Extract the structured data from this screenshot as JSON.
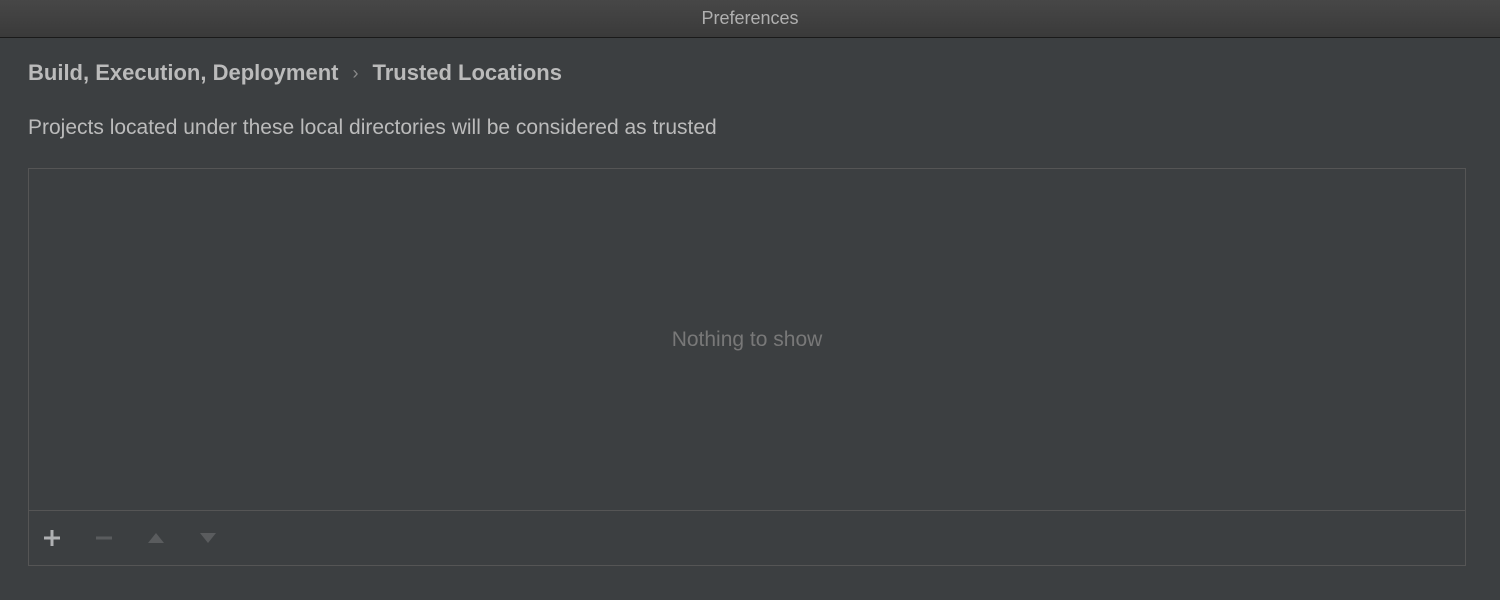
{
  "window": {
    "title": "Preferences"
  },
  "breadcrumb": {
    "parent": "Build, Execution, Deployment",
    "separator": "›",
    "current": "Trusted Locations"
  },
  "description": "Projects located under these local directories will be considered as trusted",
  "list": {
    "empty_text": "Nothing to show"
  }
}
